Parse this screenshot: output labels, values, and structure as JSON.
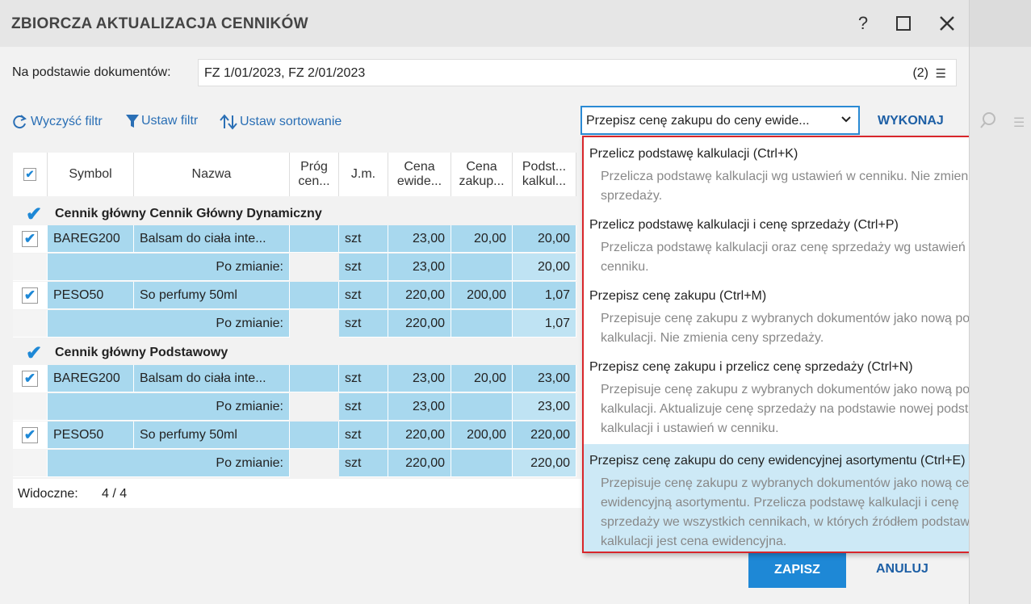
{
  "dialog": {
    "title": "ZBIORCZA AKTUALIZACJA CENNIKÓW",
    "help": "?",
    "docs_label": "Na podstawie dokumentów:",
    "docs_value": "FZ 1/01/2023, FZ 2/01/2023",
    "docs_count": "(2)"
  },
  "toolbar": {
    "clear_filter": "Wyczyść filtr",
    "set_filter": "Ustaw filtr",
    "set_sort": "Ustaw sortowanie",
    "action_selected": "Przepisz cenę zakupu do ceny ewide...",
    "execute": "WYKONAJ"
  },
  "grid": {
    "columns": [
      "Symbol",
      "Nazwa",
      "Próg cen...",
      "J.m.",
      "Cena ewide...",
      "Cena zakup...",
      "Podst... kalkul..."
    ],
    "groups": [
      {
        "name": "Cennik  główny  Cennik Główny Dynamiczny",
        "rows": [
          {
            "symbol": "BAREG200",
            "name": "Balsam do ciała inte...",
            "unit": "szt",
            "ewid": "23,00",
            "zakup": "20,00",
            "podst": "20,00",
            "after_label": "Po zmianie:",
            "after_unit": "szt",
            "after_ewid": "23,00",
            "after_podst": "20,00"
          },
          {
            "symbol": "PESO50",
            "name": "So perfumy 50ml",
            "unit": "szt",
            "ewid": "220,00",
            "zakup": "200,00",
            "podst": "1,07",
            "after_label": "Po zmianie:",
            "after_unit": "szt",
            "after_ewid": "220,00",
            "after_podst": "1,07"
          }
        ]
      },
      {
        "name": "Cennik  główny  Podstawowy",
        "rows": [
          {
            "symbol": "BAREG200",
            "name": "Balsam do ciała inte...",
            "unit": "szt",
            "ewid": "23,00",
            "zakup": "20,00",
            "podst": "23,00",
            "after_label": "Po zmianie:",
            "after_unit": "szt",
            "after_ewid": "23,00",
            "after_podst": "23,00"
          },
          {
            "symbol": "PESO50",
            "name": "So perfumy 50ml",
            "unit": "szt",
            "ewid": "220,00",
            "zakup": "200,00",
            "podst": "220,00",
            "after_label": "Po zmianie:",
            "after_unit": "szt",
            "after_ewid": "220,00",
            "after_podst": "220,00"
          }
        ]
      }
    ],
    "visible_label": "Widoczne:",
    "visible_value": "4 /  4"
  },
  "dropdown": {
    "options": [
      {
        "title": "Przelicz podstawę kalkulacji  (Ctrl+K)",
        "desc": "Przelicza podstawę kalkulacji wg ustawień w cenniku. Nie zmienia ceny sprzedaży."
      },
      {
        "title": "Przelicz podstawę kalkulacji i cenę sprzedaży  (Ctrl+P)",
        "desc": "Przelicza podstawę kalkulacji oraz cenę sprzedaży wg ustawień w cenniku."
      },
      {
        "title": "Przepisz cenę zakupu  (Ctrl+M)",
        "desc": "Przepisuje cenę zakupu z wybranych dokumentów jako nową podstawę kalkulacji. Nie zmienia ceny sprzedaży."
      },
      {
        "title": "Przepisz cenę zakupu i przelicz cenę sprzedaży  (Ctrl+N)",
        "desc": "Przepisuje cenę zakupu z wybranych dokumentów jako nową podstawę kalkulacji. Aktualizuje cenę sprzedaży na podstawie nowej podstawy kalkulacji i ustawień w cenniku."
      },
      {
        "title": "Przepisz cenę zakupu do ceny ewidencyjnej asortymentu  (Ctrl+E)",
        "desc": "Przepisuje cenę zakupu z wybranych dokumentów jako nową cenę ewidencyjną asortymentu. Przelicza podstawę kalkulacji i cenę sprzedaży we wszystkich cennikach, w których źródłem podstawy kalkulacji jest cena ewidencyjna."
      }
    ]
  },
  "footer": {
    "save": "ZAPISZ",
    "cancel": "ANULUJ"
  }
}
